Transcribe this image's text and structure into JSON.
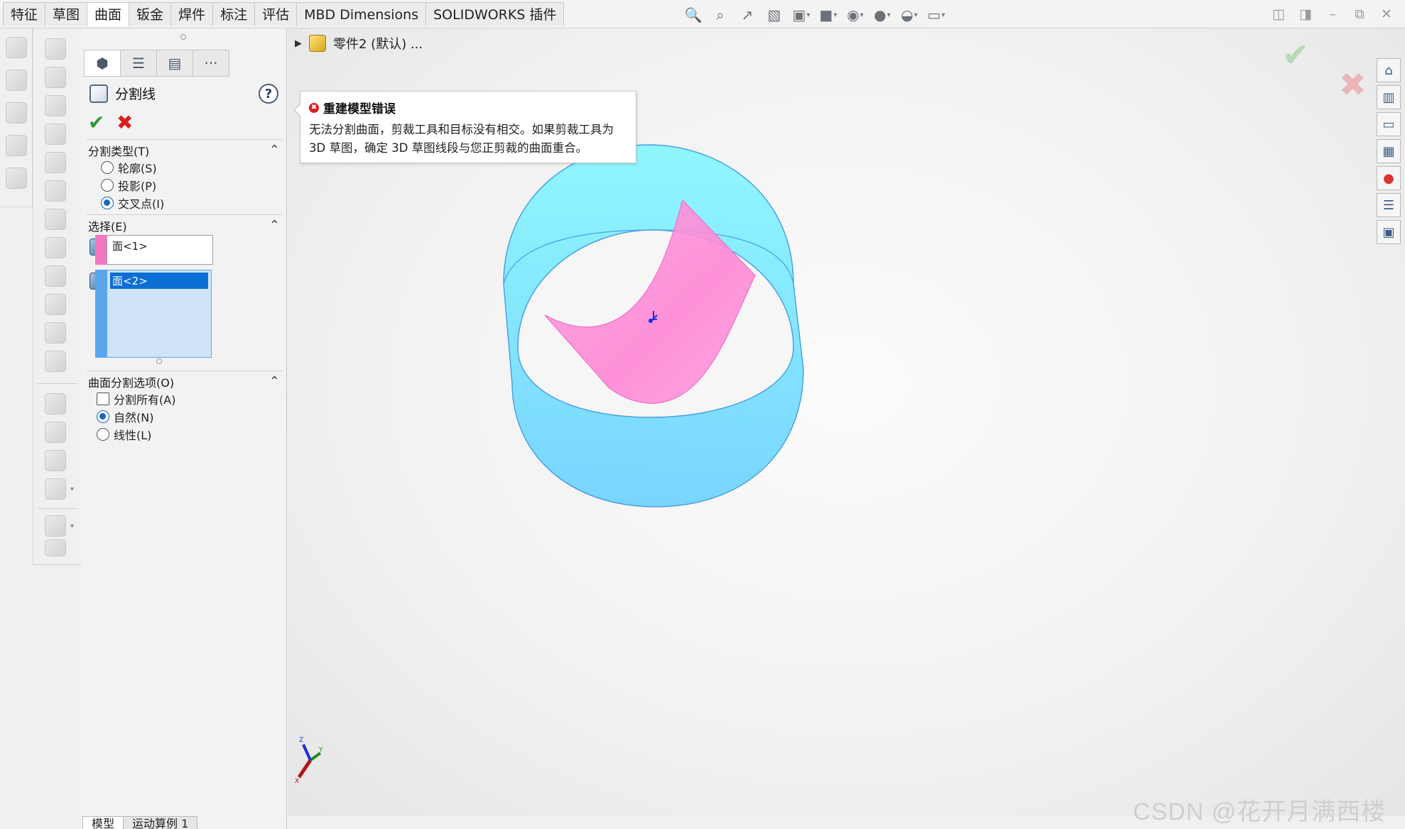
{
  "tabs": [
    "特征",
    "草图",
    "曲面",
    "钣金",
    "焊件",
    "标注",
    "评估",
    "MBD Dimensions",
    "SOLIDWORKS 插件"
  ],
  "active_tab": "曲面",
  "property_manager": {
    "title": "分割线",
    "help_label": "?",
    "more_label": "···",
    "split_type": {
      "header": "分割类型(T)",
      "options": [
        "轮廓(S)",
        "投影(P)",
        "交叉点(I)"
      ],
      "selected": "交叉点(I)"
    },
    "selections": {
      "header": "选择(E)",
      "list1": [
        "面<1>"
      ],
      "list2": [
        "面<2>"
      ]
    },
    "surface_split_options": {
      "header": "曲面分割选项(O)",
      "split_all_label": "分割所有(A)",
      "split_all_checked": false,
      "options": [
        "自然(N)",
        "线性(L)"
      ],
      "selected": "自然(N)"
    }
  },
  "bottom_tabs": [
    "模型",
    "运动算例 1"
  ],
  "feature_tree": {
    "part_label": "零件2 (默认) ..."
  },
  "error_tooltip": {
    "title": "重建模型错误",
    "message": "无法分割曲面，剪裁工具和目标没有相交。如果剪裁工具为 3D 草图，确定 3D 草图线段与您正剪裁的曲面重合。"
  },
  "triad": {
    "x": "X",
    "y": "Y",
    "z": "Z"
  },
  "watermark": "CSDN @花开月满西楼",
  "colors": {
    "cylinder": "#6fe3ff",
    "surface": "#ff8fd8",
    "selection_pink": "#f178c0",
    "selection_blue": "#5aa6ea",
    "ok_green": "#2f9a2f",
    "cancel_red": "#d91f1f"
  },
  "icons": {
    "view_toolbar": [
      "zoom-fit-icon",
      "zoom-area-icon",
      "previous-view-icon",
      "section-view-icon",
      "view-orientation-icon",
      "display-style-icon",
      "hide-show-icon",
      "edit-appearance-icon",
      "apply-scene-icon",
      "view-settings-icon"
    ],
    "window": [
      "tile-left-icon",
      "tile-right-icon",
      "minimize-icon",
      "restore-icon",
      "close-icon"
    ],
    "task_pane": [
      "home-icon",
      "resources-icon",
      "file-explorer-icon",
      "view-palette-icon",
      "appearances-icon",
      "custom-properties-icon",
      "forum-icon"
    ]
  }
}
